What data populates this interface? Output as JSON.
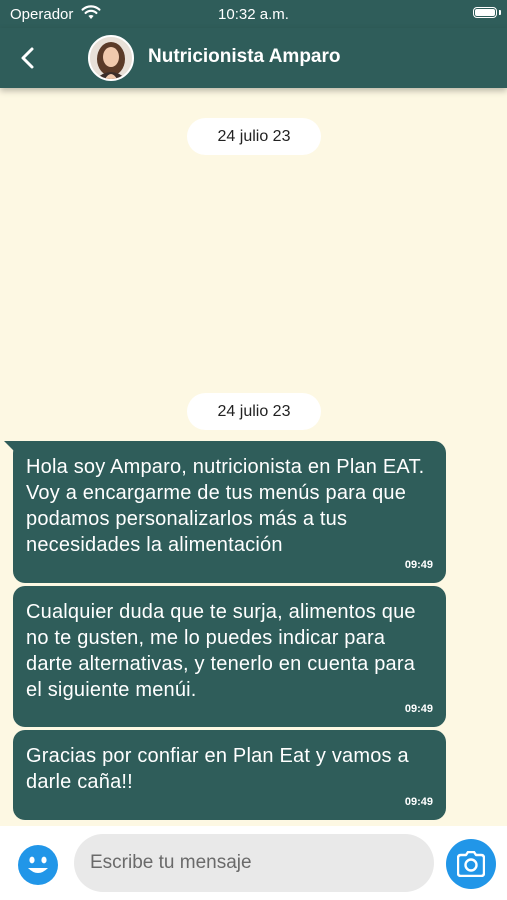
{
  "status_bar": {
    "carrier": "Operador",
    "time": "10:32 a.m."
  },
  "header": {
    "contact_name": "Nutricionista Amparo",
    "back_icon": "chevron-left-icon"
  },
  "chat": {
    "date_separators": [
      "24 julio 23",
      "24 julio 23"
    ],
    "messages": [
      {
        "text": "Hola soy Amparo, nutricionista en Plan EAT. Voy a encargarme de tus menús para que podamos personalizarlos más a tus necesidades la alimentación",
        "time": "09:49"
      },
      {
        "text": "Cualquier duda que te surja, alimentos que no te gusten, me lo puedes indicar para darte alternativas, y tenerlo en cuenta para el siguiente menúi.",
        "time": "09:49"
      },
      {
        "text": "Gracias por confiar en Plan Eat  y vamos a darle caña!!",
        "time": "09:49"
      }
    ]
  },
  "composer": {
    "placeholder": "Escribe tu mensaje",
    "emoji_icon": "emoji-icon",
    "camera_icon": "camera-icon"
  },
  "colors": {
    "primary": "#2f5d5a",
    "chat_background": "#fdf8e3",
    "accent_blue": "#2196e8"
  }
}
